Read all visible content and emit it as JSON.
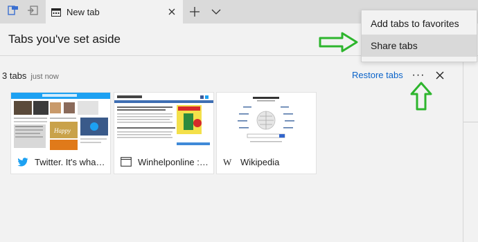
{
  "tabstrip": {
    "active_tab_title": "New tab",
    "new_tab_symbol": "+",
    "tab_list_symbol": "⌵"
  },
  "panel": {
    "title": "Tabs you've set aside"
  },
  "group": {
    "count": "3 tabs",
    "time": "just now",
    "restore_label": "Restore tabs",
    "more_label": "···"
  },
  "tabs": [
    {
      "title": "Twitter. It's what's happening",
      "icon": "twitter-bird-icon"
    },
    {
      "title": "Winhelponline :: Windows tips",
      "icon": "page-icon"
    },
    {
      "title": "Wikipedia",
      "icon": "wikipedia-w-icon"
    }
  ],
  "menu": {
    "items": [
      {
        "label": "Add tabs to favorites"
      },
      {
        "label": "Share tabs"
      }
    ]
  },
  "colors": {
    "link": "#0a63c9",
    "annotation_arrow": "#2db52d",
    "twitter": "#1da1f2"
  }
}
